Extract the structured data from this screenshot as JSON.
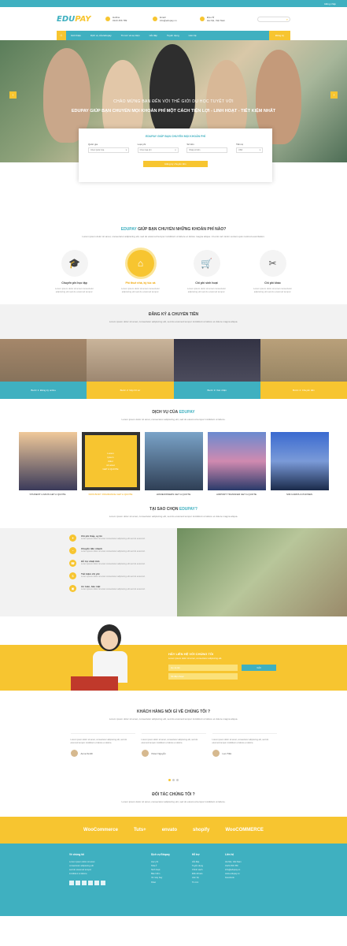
{
  "topbar": {
    "text": "Đăng nhập"
  },
  "header": {
    "logo_main": "EDU",
    "logo_accent": "PAY",
    "info": [
      {
        "line1": "Hotline",
        "line2": "0123 456 789"
      },
      {
        "line1": "Email",
        "line2": "info@edupay.vn"
      },
      {
        "line1": "Địa chỉ",
        "line2": "Hà Nội, Việt Nam"
      }
    ],
    "search_icon": "search-icon"
  },
  "nav": {
    "items": [
      "Giới thiệu",
      "Dịch vụ của Edupay",
      "Tin tức và sự kiện",
      "Hỏi đáp",
      "Tuyển dụng",
      "Liên hệ"
    ],
    "cta": "Đăng ký"
  },
  "hero": {
    "caption1": "CHÀO MỪNG BẠN ĐẾN VỚI THẾ GIỚI DU HỌC TUYỆT VỜI",
    "caption2": "EDUPAY GIÚP BẠN CHUYỂN MỌI KHOẢN PHÍ MỘT CÁCH TIỆN LỢI - LINH HOẠT - TIẾT KIỆM NHẤT",
    "prev": "‹",
    "next": "›"
  },
  "feeform": {
    "title": "EDUPAY GIÚP BẠN CHUYỂN MỌI KHOẢN PHÍ",
    "fields": [
      {
        "label": "Quốc gia",
        "value": "Chọn Quốc Gia"
      },
      {
        "label": "Loại phí",
        "value": "Chọn loại phí"
      },
      {
        "label": "Số tiền",
        "value": "Nhập số tiền"
      },
      {
        "label": "Tiền tệ",
        "value": "USD"
      }
    ],
    "button": "Đăng ký chuyển tiền"
  },
  "intro": {
    "title_accent": "EDUPAY",
    "title_rest": " GIÚP BẠN CHUYỂN NHỮNG KHOẢN PHÍ NÀO?",
    "sub": "Lorem ipsum dolor sit amet, consectetur adipiscing elit, sed do eiusmod tempor incididunt ut labore et dolore magna aliqua. Ut enim ad minim veniam quis nostrud exercitation."
  },
  "features": [
    {
      "icon": "graduation-cap-icon",
      "glyph": "🎓",
      "title": "Chuyển phí học tập",
      "desc": "Lorem ipsum dolor sit amet consectetur adipiscing elit sed do eiusmod tempor."
    },
    {
      "icon": "home-icon",
      "glyph": "⌂",
      "title": "Phí thuê nhà, ký túc xá",
      "desc": "Lorem ipsum dolor sit amet consectetur adipiscing elit sed do eiusmod tempor."
    },
    {
      "icon": "cart-icon",
      "glyph": "🛒",
      "title": "Chi phí sinh hoạt",
      "desc": "Lorem ipsum dolor sit amet consectetur adipiscing elit sed do eiusmod tempor."
    },
    {
      "icon": "tools-icon",
      "glyph": "✂",
      "title": "Chi phí khác",
      "desc": "Lorem ipsum dolor sit amet consectetur adipiscing elit sed do eiusmod tempor."
    }
  ],
  "register": {
    "title": "ĐĂNG KÝ & CHUYỂN TIỀN",
    "sub": "Lorem ipsum dolor sit amet, consectetur adipiscing elit, sed do eiusmod tempor incididunt ut labore et dolore magna aliqua."
  },
  "steps": [
    "Bước 1: Đăng ký online",
    "Bước 2: Nộp hồ sơ",
    "Bước 3: Xác nhận",
    "Bước 4: Chuyển tiền"
  ],
  "services": {
    "title": "DỊCH VỤ CỦA",
    "title_accent": "EDUPAY",
    "sub": "Lorem ipsum dolor sit amet, consectetur adipiscing elit, sed do eiusmod tempor incididunt ut labore.",
    "items": [
      "STUDENT LOANS GET A QUOTE",
      "KIDS BODY INSURANCE GET A QUOTE",
      "HOMEOWNERS GET A QUOTE",
      "AIRPORT TRANSFER GET A QUOTE",
      "SIM CARDS & PHONES"
    ],
    "overlay": [
      "Lorem",
      "ipsum",
      "dolor",
      "sit amet",
      "GET A QUOTE"
    ]
  },
  "why": {
    "title": "TẠI SAO CHỌN",
    "title_accent": "EDUPAY?",
    "sub": "Lorem ipsum dolor sit amet, consectetur adipiscing elit, sed do eiusmod tempor incididunt ut labore et dolore magna aliqua.",
    "items": [
      {
        "icon": "handshake-icon",
        "title": "Chi phí thấp, uy tín",
        "desc": "Lorem ipsum dolor sit amet consectetur adipiscing elit sed do eiusmod."
      },
      {
        "icon": "clock-icon",
        "title": "Chuyển tiền nhanh",
        "desc": "Lorem ipsum dolor sit amet consectetur adipiscing elit sed do eiusmod."
      },
      {
        "icon": "support-icon",
        "title": "Hỗ trợ nhiệt tình",
        "desc": "Lorem ipsum dolor sit amet consectetur adipiscing elit sed do eiusmod."
      },
      {
        "icon": "piggy-bank-icon",
        "title": "Tiết kiệm chi phí",
        "desc": "Lorem ipsum dolor sit amet consectetur adipiscing elit sed do eiusmod."
      },
      {
        "icon": "lock-icon",
        "title": "An toàn, bảo mật",
        "desc": "Lorem ipsum dolor sit amet consectetur adipiscing elit sed do eiusmod."
      }
    ]
  },
  "contact": {
    "title": "HÃY LIÊN HỆ VỚI CHÚNG TÔI",
    "sub": "Lorem ipsum dolor sit amet, consectetur adipiscing elit.",
    "name_placeholder": "Họ và tên",
    "phone_placeholder": "Số điện thoại",
    "button": "Gửi"
  },
  "testimonials": {
    "title": "KHÁCH HÀNG NÓI GÌ VỀ CHÚNG TÔI ?",
    "sub": "Lorem ipsum dolor sit amet, consectetur adipiscing elit, sed do eiusmod tempor incididunt ut labore et dolore magna aliqua.",
    "items": [
      {
        "quote": "Lorem ipsum dolor sit amet, consectetur adipiscing elit, sed do eiusmod tempor incididunt ut labore et dolore.",
        "name": "Anna Smith"
      },
      {
        "quote": "Lorem ipsum dolor sit amet, consectetur adipiscing elit, sed do eiusmod tempor incididunt ut labore et dolore.",
        "name": "Peter Nguyễn"
      },
      {
        "quote": "Lorem ipsum dolor sit amet, consectetur adipiscing elit, sed do eiusmod tempor incididunt ut labore et dolore.",
        "name": "Lan Trần"
      }
    ]
  },
  "partners": {
    "title": "ĐỐI TÁC CHÚNG TÔI ?",
    "sub": "Lorem ipsum dolor sit amet, consectetur adipiscing elit, sed do eiusmod tempor incididunt ut labore.",
    "logos": [
      "WooCommerce",
      "Tuts+",
      "envato",
      "shopify",
      "WooCOMMERCE"
    ]
  },
  "footer": {
    "cols": [
      {
        "head": "Về chúng tôi",
        "links": [
          "Lorem ipsum dolor sit amet",
          "consectetur adipiscing elit",
          "sed do eiusmod tempor",
          "incididunt ut labore"
        ]
      },
      {
        "head": "Dịch vụ Edupay",
        "links": [
          "Học phí",
          "Nhà ở",
          "Sinh hoạt",
          "Bảo hiểm",
          "Vé máy bay",
          "Khác"
        ]
      },
      {
        "head": "Hỗ trợ",
        "links": [
          "Hỏi đáp",
          "Tuyển dụng",
          "Chính sách",
          "Điều khoản",
          "Liên hệ",
          "Tin tức"
        ]
      },
      {
        "head": "Liên hệ",
        "links": [
          "Hà Nội, Việt Nam",
          "0123 456 789",
          "info@edupay.vn",
          "www.edupay.vn",
          "Facebook"
        ]
      }
    ],
    "social": [
      "facebook-icon",
      "twitter-icon",
      "google-plus-icon",
      "youtube-icon",
      "linkedin-icon",
      "rss-icon"
    ]
  }
}
